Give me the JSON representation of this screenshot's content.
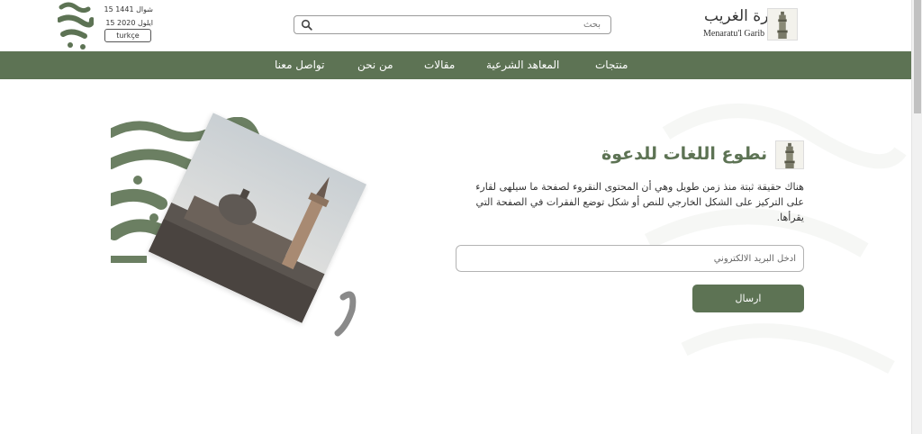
{
  "header": {
    "logo": {
      "name_ar": "منارة الغريب",
      "name_en": "Menaratu'l Garib"
    },
    "search": {
      "placeholder": "بحث",
      "icon": "search-icon"
    },
    "dates": {
      "hijri": "15 شوال 1441",
      "gregorian": "15 ايلول 2020"
    },
    "language_button": "turkçe"
  },
  "nav": {
    "items": [
      {
        "label": "منتجات"
      },
      {
        "label": "المعاهد الشرعية"
      },
      {
        "label": "مقالات"
      },
      {
        "label": "من نحن"
      },
      {
        "label": "تواصل معنا"
      }
    ]
  },
  "main": {
    "title": "نطوع اللغات للدعوة",
    "description": "هناك حقيقة ثبتة منذ زمن طويل وهي أن المحتوى النقروء لصفحة ما سيلهى لقارء على التركيز على الشكل الخارجي للنص أو شكل توضع الفقرات في الصفحة التي يقرأها.",
    "email_placeholder": "ادخل البريد الالكتروني",
    "submit_label": "ارسال"
  },
  "colors": {
    "brand_green": "#5d7354"
  }
}
